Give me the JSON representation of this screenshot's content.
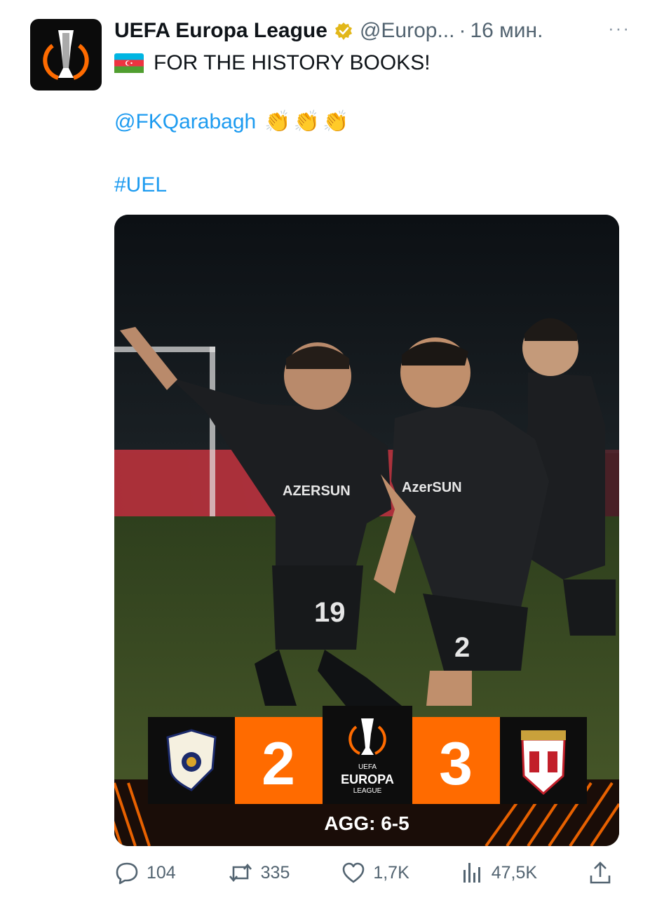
{
  "tweet": {
    "display_name": "UEFA Europa League",
    "handle": "@Europ...",
    "separator": "·",
    "time": "16 мин.",
    "more": "···",
    "line1": "FOR THE HISTORY BOOKS!",
    "mention": "@FKQarabagh",
    "claps": "👏👏👏",
    "hashtag": "#UEL"
  },
  "media": {
    "score_home": "2",
    "score_away": "3",
    "logo_text_top": "UEFA",
    "logo_text_main": "EUROPA",
    "logo_text_sub": "LEAGUE",
    "aggregate": "AGG: 6-5",
    "shirt_sponsor_1": "AZERSUN",
    "shirt_sponsor_2": "AzerSUN",
    "shirt_number_left": "19",
    "shirt_number_center": "2"
  },
  "actions": {
    "replies": "104",
    "reposts": "335",
    "likes": "1,7K",
    "views": "47,5K"
  },
  "colors": {
    "accent_orange": "#ff6b00",
    "link_blue": "#1d9bf0",
    "verified_gold": "#e2b719"
  }
}
